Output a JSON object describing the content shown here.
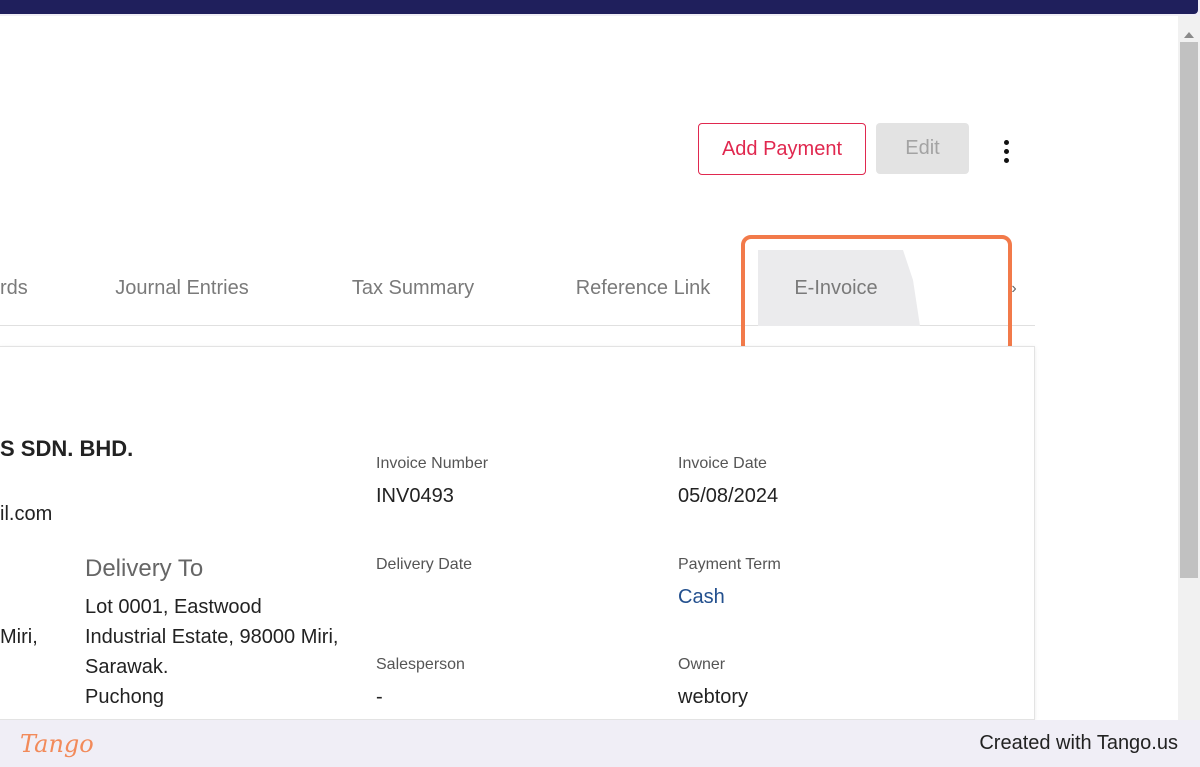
{
  "header": {
    "add_payment_label": "Add Payment",
    "edit_label": "Edit"
  },
  "tabs": [
    {
      "label": "rds"
    },
    {
      "label": "Journal Entries"
    },
    {
      "label": "Tax Summary"
    },
    {
      "label": "Reference Link"
    },
    {
      "label": "E-Invoice",
      "active": true
    }
  ],
  "invoice": {
    "company_name": "S SDN. BHD.",
    "email_fragment": "il.com",
    "address_fragment": "Miri,",
    "delivery_heading": "Delivery To",
    "delivery_lines": [
      "Lot 0001, Eastwood",
      "Industrial Estate, 98000 Miri,",
      "Sarawak.",
      "Puchong"
    ],
    "invoice_number_label": "Invoice Number",
    "invoice_number": "INV0493",
    "invoice_date_label": "Invoice Date",
    "invoice_date": "05/08/2024",
    "delivery_date_label": "Delivery Date",
    "payment_term_label": "Payment Term",
    "payment_term": "Cash",
    "salesperson_label": "Salesperson",
    "salesperson": "-",
    "owner_label": "Owner",
    "owner": "webtory"
  },
  "footer": {
    "logo_text": "Tango",
    "credit": "Created with Tango.us"
  },
  "colors": {
    "accent": "#e0284f",
    "highlight": "#f27a4a",
    "link": "#23508e",
    "topbar": "#1f1f5c"
  }
}
